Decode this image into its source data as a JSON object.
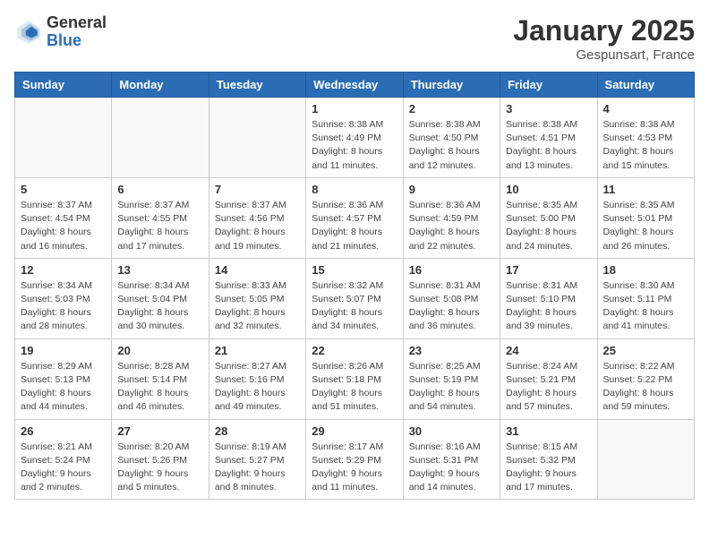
{
  "header": {
    "logo_line1": "General",
    "logo_line2": "Blue",
    "month_year": "January 2025",
    "location": "Gespunsart, France"
  },
  "weekdays": [
    "Sunday",
    "Monday",
    "Tuesday",
    "Wednesday",
    "Thursday",
    "Friday",
    "Saturday"
  ],
  "weeks": [
    [
      {
        "day": "",
        "info": ""
      },
      {
        "day": "",
        "info": ""
      },
      {
        "day": "",
        "info": ""
      },
      {
        "day": "1",
        "info": "Sunrise: 8:38 AM\nSunset: 4:49 PM\nDaylight: 8 hours\nand 11 minutes."
      },
      {
        "day": "2",
        "info": "Sunrise: 8:38 AM\nSunset: 4:50 PM\nDaylight: 8 hours\nand 12 minutes."
      },
      {
        "day": "3",
        "info": "Sunrise: 8:38 AM\nSunset: 4:51 PM\nDaylight: 8 hours\nand 13 minutes."
      },
      {
        "day": "4",
        "info": "Sunrise: 8:38 AM\nSunset: 4:53 PM\nDaylight: 8 hours\nand 15 minutes."
      }
    ],
    [
      {
        "day": "5",
        "info": "Sunrise: 8:37 AM\nSunset: 4:54 PM\nDaylight: 8 hours\nand 16 minutes."
      },
      {
        "day": "6",
        "info": "Sunrise: 8:37 AM\nSunset: 4:55 PM\nDaylight: 8 hours\nand 17 minutes."
      },
      {
        "day": "7",
        "info": "Sunrise: 8:37 AM\nSunset: 4:56 PM\nDaylight: 8 hours\nand 19 minutes."
      },
      {
        "day": "8",
        "info": "Sunrise: 8:36 AM\nSunset: 4:57 PM\nDaylight: 8 hours\nand 21 minutes."
      },
      {
        "day": "9",
        "info": "Sunrise: 8:36 AM\nSunset: 4:59 PM\nDaylight: 8 hours\nand 22 minutes."
      },
      {
        "day": "10",
        "info": "Sunrise: 8:35 AM\nSunset: 5:00 PM\nDaylight: 8 hours\nand 24 minutes."
      },
      {
        "day": "11",
        "info": "Sunrise: 8:35 AM\nSunset: 5:01 PM\nDaylight: 8 hours\nand 26 minutes."
      }
    ],
    [
      {
        "day": "12",
        "info": "Sunrise: 8:34 AM\nSunset: 5:03 PM\nDaylight: 8 hours\nand 28 minutes."
      },
      {
        "day": "13",
        "info": "Sunrise: 8:34 AM\nSunset: 5:04 PM\nDaylight: 8 hours\nand 30 minutes."
      },
      {
        "day": "14",
        "info": "Sunrise: 8:33 AM\nSunset: 5:05 PM\nDaylight: 8 hours\nand 32 minutes."
      },
      {
        "day": "15",
        "info": "Sunrise: 8:32 AM\nSunset: 5:07 PM\nDaylight: 8 hours\nand 34 minutes."
      },
      {
        "day": "16",
        "info": "Sunrise: 8:31 AM\nSunset: 5:08 PM\nDaylight: 8 hours\nand 36 minutes."
      },
      {
        "day": "17",
        "info": "Sunrise: 8:31 AM\nSunset: 5:10 PM\nDaylight: 8 hours\nand 39 minutes."
      },
      {
        "day": "18",
        "info": "Sunrise: 8:30 AM\nSunset: 5:11 PM\nDaylight: 8 hours\nand 41 minutes."
      }
    ],
    [
      {
        "day": "19",
        "info": "Sunrise: 8:29 AM\nSunset: 5:13 PM\nDaylight: 8 hours\nand 44 minutes."
      },
      {
        "day": "20",
        "info": "Sunrise: 8:28 AM\nSunset: 5:14 PM\nDaylight: 8 hours\nand 46 minutes."
      },
      {
        "day": "21",
        "info": "Sunrise: 8:27 AM\nSunset: 5:16 PM\nDaylight: 8 hours\nand 49 minutes."
      },
      {
        "day": "22",
        "info": "Sunrise: 8:26 AM\nSunset: 5:18 PM\nDaylight: 8 hours\nand 51 minutes."
      },
      {
        "day": "23",
        "info": "Sunrise: 8:25 AM\nSunset: 5:19 PM\nDaylight: 8 hours\nand 54 minutes."
      },
      {
        "day": "24",
        "info": "Sunrise: 8:24 AM\nSunset: 5:21 PM\nDaylight: 8 hours\nand 57 minutes."
      },
      {
        "day": "25",
        "info": "Sunrise: 8:22 AM\nSunset: 5:22 PM\nDaylight: 8 hours\nand 59 minutes."
      }
    ],
    [
      {
        "day": "26",
        "info": "Sunrise: 8:21 AM\nSunset: 5:24 PM\nDaylight: 9 hours\nand 2 minutes."
      },
      {
        "day": "27",
        "info": "Sunrise: 8:20 AM\nSunset: 5:26 PM\nDaylight: 9 hours\nand 5 minutes."
      },
      {
        "day": "28",
        "info": "Sunrise: 8:19 AM\nSunset: 5:27 PM\nDaylight: 9 hours\nand 8 minutes."
      },
      {
        "day": "29",
        "info": "Sunrise: 8:17 AM\nSunset: 5:29 PM\nDaylight: 9 hours\nand 11 minutes."
      },
      {
        "day": "30",
        "info": "Sunrise: 8:16 AM\nSunset: 5:31 PM\nDaylight: 9 hours\nand 14 minutes."
      },
      {
        "day": "31",
        "info": "Sunrise: 8:15 AM\nSunset: 5:32 PM\nDaylight: 9 hours\nand 17 minutes."
      },
      {
        "day": "",
        "info": ""
      }
    ]
  ]
}
